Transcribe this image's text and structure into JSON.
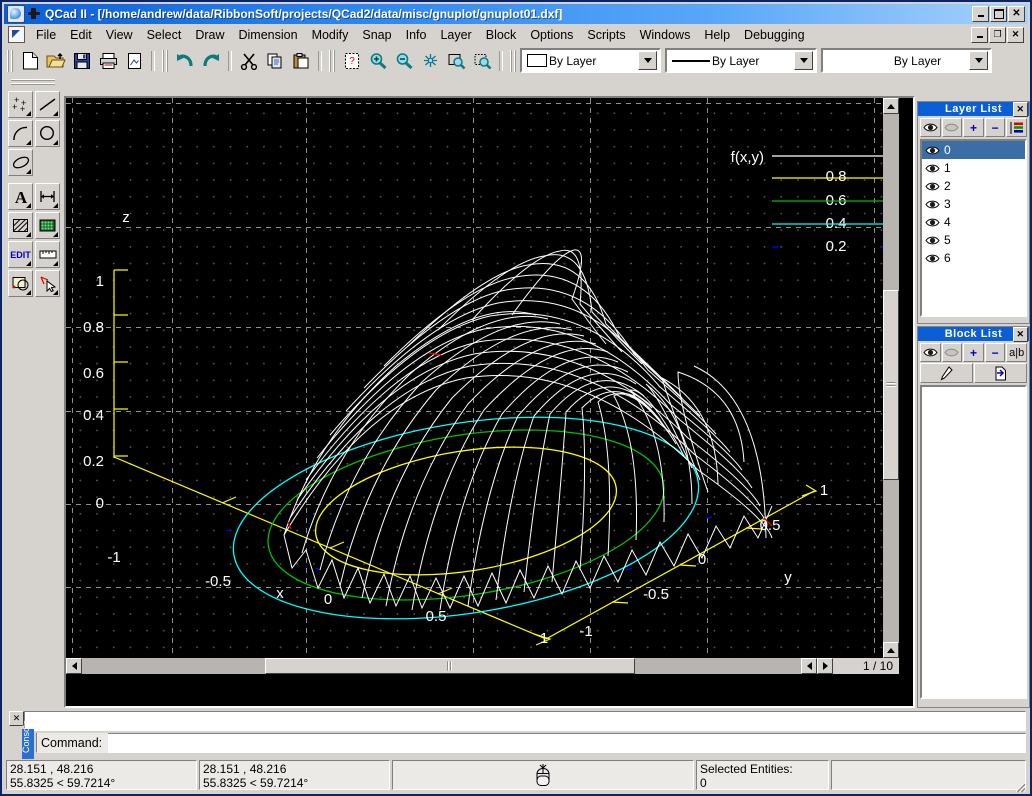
{
  "window": {
    "app_title": "QCad II - [/home/andrew/data/RibbonSoft/projects/QCad2/data/misc/gnuplot/gnuplot01.dxf]",
    "minimize_label": "_",
    "maximize_label": "□",
    "close_label": "✕",
    "titlebar_color": "#0a5fd6"
  },
  "menu": {
    "items": [
      {
        "label": "File"
      },
      {
        "label": "Edit"
      },
      {
        "label": "View"
      },
      {
        "label": "Select"
      },
      {
        "label": "Draw"
      },
      {
        "label": "Dimension"
      },
      {
        "label": "Modify"
      },
      {
        "label": "Snap"
      },
      {
        "label": "Info"
      },
      {
        "label": "Layer"
      },
      {
        "label": "Block"
      },
      {
        "label": "Options"
      },
      {
        "label": "Scripts"
      },
      {
        "label": "Windows"
      },
      {
        "label": "Help"
      },
      {
        "label": "Debugging"
      }
    ],
    "mdi_minimize": "_",
    "mdi_restore": "❐",
    "mdi_close": "✕"
  },
  "toolbar": {
    "buttons": [
      {
        "name": "new-file-icon",
        "tip": "New"
      },
      {
        "name": "open-file-icon",
        "tip": "Open"
      },
      {
        "name": "save-file-icon",
        "tip": "Save"
      },
      {
        "name": "print-icon",
        "tip": "Print"
      },
      {
        "name": "print-preview-icon",
        "tip": "Print Preview"
      },
      {
        "name": "undo-icon",
        "tip": "Undo"
      },
      {
        "name": "redo-icon",
        "tip": "Redo"
      },
      {
        "name": "cut-icon",
        "tip": "Cut"
      },
      {
        "name": "copy-icon",
        "tip": "Copy"
      },
      {
        "name": "paste-icon",
        "tip": "Paste"
      },
      {
        "name": "redraw-icon",
        "tip": "Redraw"
      },
      {
        "name": "zoom-in-icon",
        "tip": "Zoom In"
      },
      {
        "name": "zoom-out-icon",
        "tip": "Zoom Out"
      },
      {
        "name": "zoom-auto-icon",
        "tip": "Auto Zoom"
      },
      {
        "name": "zoom-window-icon",
        "tip": "Zoom Window"
      },
      {
        "name": "zoom-previous-icon",
        "tip": "Previous View"
      }
    ],
    "layer_combo": {
      "value": "By Layer"
    },
    "linetype_combo": {
      "value": "By Layer"
    },
    "width_combo": {
      "value": "By Layer"
    }
  },
  "left_tools": {
    "groups": [
      [
        {
          "name": "points-tool",
          "label": "points"
        },
        {
          "name": "line-tool",
          "label": "line"
        }
      ],
      [
        {
          "name": "arc-tool",
          "label": "arc"
        },
        {
          "name": "circle-tool",
          "label": "circle"
        }
      ],
      [
        {
          "name": "ellipse-tool",
          "label": "ellipse"
        }
      ],
      [
        {
          "name": "text-tool",
          "label": "text"
        },
        {
          "name": "dimension-tool",
          "label": "dimension"
        }
      ],
      [
        {
          "name": "hatch-tool",
          "label": "hatch"
        },
        {
          "name": "image-tool",
          "label": "image"
        }
      ],
      [
        {
          "name": "edit-tool",
          "label": "EDIT"
        },
        {
          "name": "measure-tool",
          "label": "measure"
        }
      ],
      [
        {
          "name": "modify-tool",
          "label": "modify"
        },
        {
          "name": "select-tool",
          "label": "select"
        }
      ]
    ],
    "edit_label": "EDIT"
  },
  "layer_panel": {
    "title": "Layer List",
    "close_label": "✕",
    "tools": [
      {
        "name": "show-all-layers-button",
        "label": ""
      },
      {
        "name": "hide-all-layers-button",
        "label": ""
      },
      {
        "name": "add-layer-button",
        "label": "+"
      },
      {
        "name": "remove-layer-button",
        "label": "−"
      },
      {
        "name": "edit-layer-button",
        "label": ""
      }
    ],
    "rows": [
      {
        "label": "0",
        "selected": true
      },
      {
        "label": "1",
        "selected": false
      },
      {
        "label": "2",
        "selected": false
      },
      {
        "label": "3",
        "selected": false
      },
      {
        "label": "4",
        "selected": false
      },
      {
        "label": "5",
        "selected": false
      },
      {
        "label": "6",
        "selected": false
      }
    ]
  },
  "block_panel": {
    "title": "Block List",
    "close_label": "✕",
    "tools": [
      {
        "name": "show-all-blocks-button",
        "label": ""
      },
      {
        "name": "hide-all-blocks-button",
        "label": ""
      },
      {
        "name": "add-block-button",
        "label": "+"
      },
      {
        "name": "remove-block-button",
        "label": "−"
      },
      {
        "name": "rename-block-button",
        "label": "a|b"
      }
    ],
    "tools_row2": [
      {
        "name": "edit-block-button",
        "label": ""
      },
      {
        "name": "insert-block-button",
        "label": ""
      }
    ],
    "rows": []
  },
  "console": {
    "history": "",
    "prompt_label": "Command:",
    "input_value": "",
    "tab_label": "Console",
    "close_label": "✕"
  },
  "statusbar": {
    "abs_coord": "28.151 , 48.216",
    "abs_polar": "55.8325 < 59.7214°",
    "rel_coord": "28.151 , 48.216",
    "rel_polar": "55.8325 < 59.7214°",
    "mouse_hint": "",
    "selected_label": "Selected Entities:",
    "selected_count": "0"
  },
  "view": {
    "page_indicator": "1 / 10",
    "scroll_left_label": "◄",
    "scroll_right_label": "►",
    "scroll_up_label": "▲",
    "scroll_down_label": "▼"
  },
  "chart_data": {
    "type": "surface",
    "title": "",
    "legend_title": "f(x,y)",
    "legend_entries": [
      {
        "label": "f(x,y)",
        "color": "#ffffff"
      },
      {
        "label": "0.8",
        "color": "#ffff00"
      },
      {
        "label": "0.6",
        "color": "#00c000"
      },
      {
        "label": "0.4",
        "color": "#00ffff"
      },
      {
        "label": "0.2",
        "color": "#0000ff"
      }
    ],
    "xlabel": "x",
    "ylabel": "y",
    "zlabel": "z",
    "xticks": [
      "-1",
      "-0.5",
      "0",
      "0.5",
      "1"
    ],
    "yticks": [
      "-1",
      "-0.5",
      "0",
      "0.5",
      "1"
    ],
    "zticks": [
      "0",
      "0.2",
      "0.4",
      "0.6",
      "0.8",
      "1"
    ],
    "xlim": [
      -1,
      1
    ],
    "ylim": [
      -1,
      1
    ],
    "zlim": [
      0,
      1
    ],
    "contour_levels": [
      0.2,
      0.4,
      0.6,
      0.8
    ],
    "contour_colors": [
      "#0000ff",
      "#00ffff",
      "#00c000",
      "#ffff00"
    ],
    "surface_color": "#ffffff",
    "axis_color": "#ffff00",
    "background": "#000000",
    "grid": true,
    "legend_position": "top-right",
    "description": "gnuplot 3D wireframe dome surface with base contour ellipses, DXF import"
  }
}
